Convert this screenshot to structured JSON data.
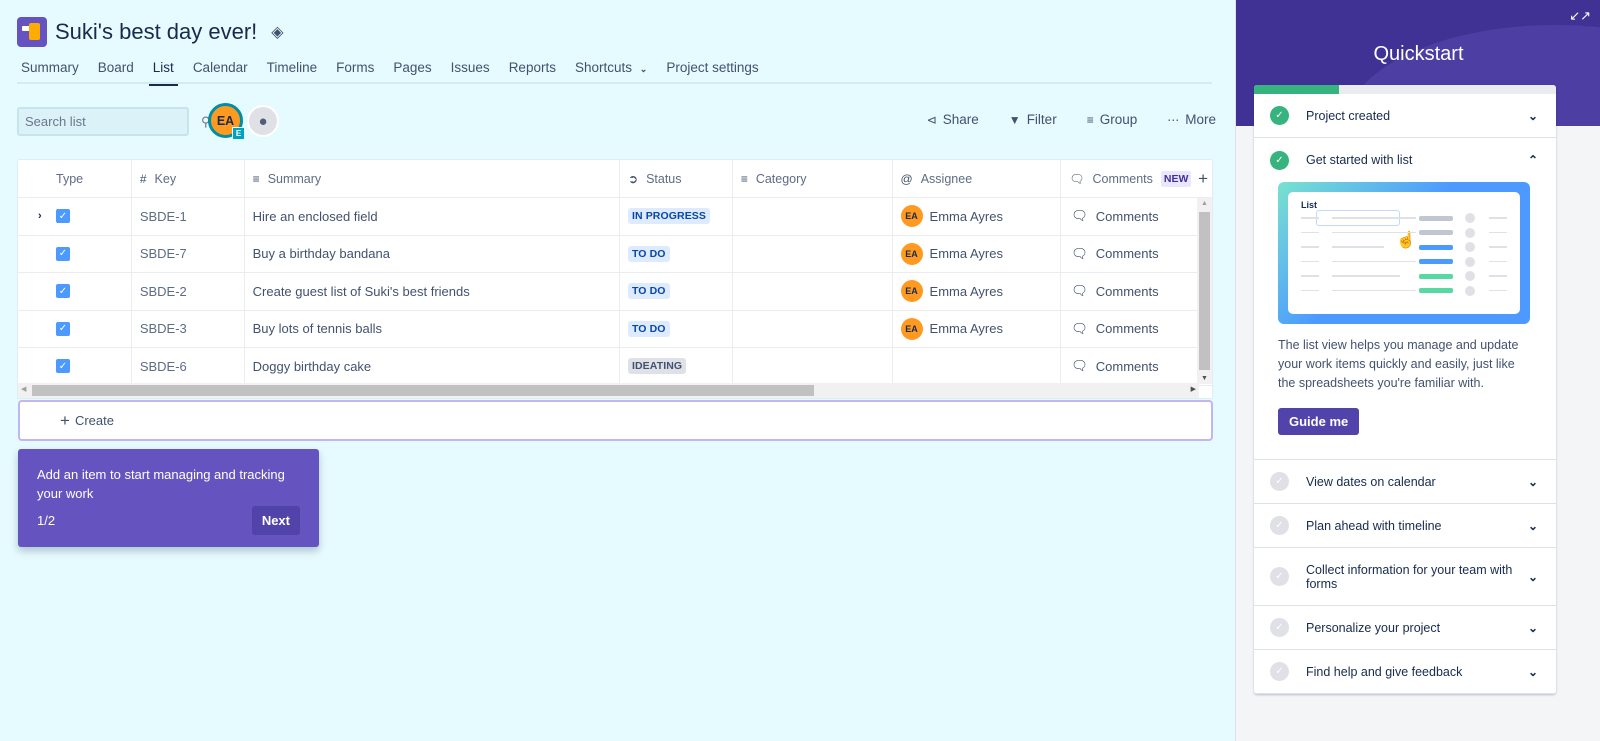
{
  "project": {
    "title": "Suki's best day ever!",
    "icon": "drill-icon",
    "theme_icon": "paint-bucket-icon"
  },
  "tabs": [
    {
      "label": "Summary",
      "active": false
    },
    {
      "label": "Board",
      "active": false
    },
    {
      "label": "List",
      "active": true
    },
    {
      "label": "Calendar",
      "active": false
    },
    {
      "label": "Timeline",
      "active": false
    },
    {
      "label": "Forms",
      "active": false
    },
    {
      "label": "Pages",
      "active": false
    },
    {
      "label": "Issues",
      "active": false
    },
    {
      "label": "Reports",
      "active": false
    },
    {
      "label": "Shortcuts",
      "active": false,
      "dropdown": true
    },
    {
      "label": "Project settings",
      "active": false
    }
  ],
  "toolbar": {
    "search_placeholder": "Search list",
    "search_value": "",
    "avatar_initials": "EA",
    "avatar_badge": "E",
    "add_people_icon": "add-person-icon",
    "actions": [
      {
        "label": "Share",
        "icon": "share-icon"
      },
      {
        "label": "Filter",
        "icon": "filter-icon"
      },
      {
        "label": "Group",
        "icon": "group-icon"
      },
      {
        "label": "More",
        "icon": "more-icon"
      }
    ]
  },
  "table": {
    "columns": [
      {
        "label": "Type",
        "icon": ""
      },
      {
        "label": "Key",
        "icon": "hash-icon"
      },
      {
        "label": "Summary",
        "icon": "text-lines-icon"
      },
      {
        "label": "Status",
        "icon": "status-arrow-icon"
      },
      {
        "label": "Category",
        "icon": "list-icon"
      },
      {
        "label": "Assignee",
        "icon": "at-icon"
      },
      {
        "label": "Comments",
        "icon": "comment-icon",
        "badge": "NEW"
      }
    ],
    "rows": [
      {
        "expandable": true,
        "checked": true,
        "key": "SBDE-1",
        "summary": "Hire an enclosed field",
        "status": "IN PROGRESS",
        "status_color": "blue",
        "category": "",
        "assignee": "Emma Ayres",
        "assignee_initials": "EA",
        "comments": "Comments"
      },
      {
        "expandable": false,
        "checked": true,
        "key": "SBDE-7",
        "summary": "Buy a birthday bandana",
        "status": "TO DO",
        "status_color": "blue",
        "category": "",
        "assignee": "Emma Ayres",
        "assignee_initials": "EA",
        "comments": "Comments"
      },
      {
        "expandable": false,
        "checked": true,
        "key": "SBDE-2",
        "summary": "Create guest list of Suki's best friends",
        "status": "TO DO",
        "status_color": "blue",
        "category": "",
        "assignee": "Emma Ayres",
        "assignee_initials": "EA",
        "comments": "Comments"
      },
      {
        "expandable": false,
        "checked": true,
        "key": "SBDE-3",
        "summary": "Buy lots of tennis balls",
        "status": "TO DO",
        "status_color": "blue",
        "category": "",
        "assignee": "Emma Ayres",
        "assignee_initials": "EA",
        "comments": "Comments"
      },
      {
        "expandable": false,
        "checked": true,
        "key": "SBDE-6",
        "summary": "Doggy birthday cake",
        "status": "IDEATING",
        "status_color": "gray",
        "category": "",
        "assignee": "",
        "assignee_initials": "",
        "comments": "Comments"
      }
    ],
    "create_label": "Create"
  },
  "tip": {
    "text": "Add an item to start managing and tracking your work",
    "count": "1/2",
    "next_label": "Next"
  },
  "quickstart": {
    "title": "Quickstart",
    "progress": 0.28,
    "items": [
      {
        "label": "Project created",
        "done": true,
        "expanded": false
      },
      {
        "label": "Get started with list",
        "done": true,
        "expanded": true
      },
      {
        "label": "View dates on calendar",
        "done": false,
        "expanded": false
      },
      {
        "label": "Plan ahead with timeline",
        "done": false,
        "expanded": false
      },
      {
        "label": "Collect information for your team with forms",
        "done": false,
        "expanded": false
      },
      {
        "label": "Personalize your project",
        "done": false,
        "expanded": false
      },
      {
        "label": "Find help and give feedback",
        "done": false,
        "expanded": false
      }
    ],
    "expanded_content": {
      "illustration_title": "List",
      "description": "The list view helps you manage and update your work items quickly and easily, just like the spreadsheets you're familiar with.",
      "button_label": "Guide me"
    }
  }
}
